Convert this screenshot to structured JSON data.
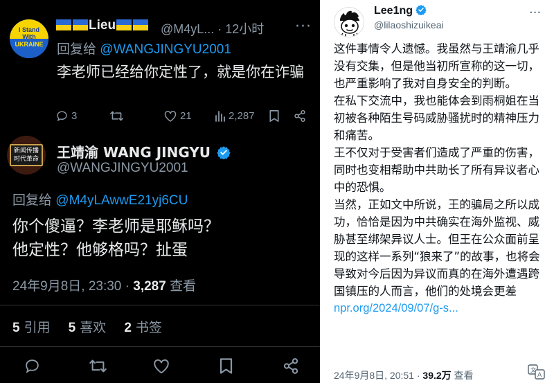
{
  "left_panel": {
    "tweet1": {
      "avatar_top": "I Stand With",
      "avatar_bottom": "UKRAINE",
      "name": "Lieu",
      "handle": "@M4yL... · 12小时",
      "reply_prefix": "回复给 ",
      "reply_mention": "@WANGJINGYU2001",
      "body": "李老师已经给你定性了，就是你在诈骗",
      "replies": "3",
      "retweets": "",
      "likes": "21",
      "views": "2,287"
    },
    "tweet2": {
      "avatar_text": "新闻传播 时代革命",
      "name": "王靖渝 WANG JINGYU",
      "handle": "@WANGJINGYU2001",
      "reply_prefix": "回复给 ",
      "reply_mention": "@M4yLAwwE21yj6CU",
      "body_line1": "你个傻逼？李老师是耶稣吗？",
      "body_line2": "他定性？他够格吗？扯蛋",
      "date": "24年9月8日, 23:30 · ",
      "views_count": "3,287",
      "views_label": " 查看",
      "quotes_count": "5",
      "quotes_label": " 引用",
      "likes_count": "5",
      "likes_label": " 喜欢",
      "bookmarks_count": "2",
      "bookmarks_label": " 书签"
    }
  },
  "right_panel": {
    "name": "Lee1ng",
    "handle": "@lilaoshizuikeai",
    "paragraphs": [
      "这件事情令人遗憾。我虽然与王靖渝几乎没有交集，但是他当初所宣称的这一切，也严重影响了我对自身安全的判断。",
      "在私下交流中，我也能体会到雨桐姐在当初被各种陌生号码威胁骚扰时的精神压力和痛苦。",
      "王不仅对于受害者们造成了严重的伤害，同时也变相帮助中共助长了所有异议者心中的恐惧。",
      "当然，正如文中所说，王的骗局之所以成功，恰恰是因为中共确实在海外监视、威胁甚至绑架异议人士。但王在公众面前呈现的这样一系列“狼来了”的故事，也将会导致对今后因为异议而真的在海外遭遇跨国镇压的人而言，他们的处境会更差"
    ],
    "link": "npr.org/2024/09/07/g-s...",
    "date": "24年9月8日, 20:51 · ",
    "views_count": "39.2万",
    "views_label": " 查看"
  },
  "colors": {
    "dark_bg": "#000000",
    "accent_blue": "#1d9bf0",
    "dark_text": "#e7e9ea",
    "dark_muted": "#8b98a5"
  }
}
